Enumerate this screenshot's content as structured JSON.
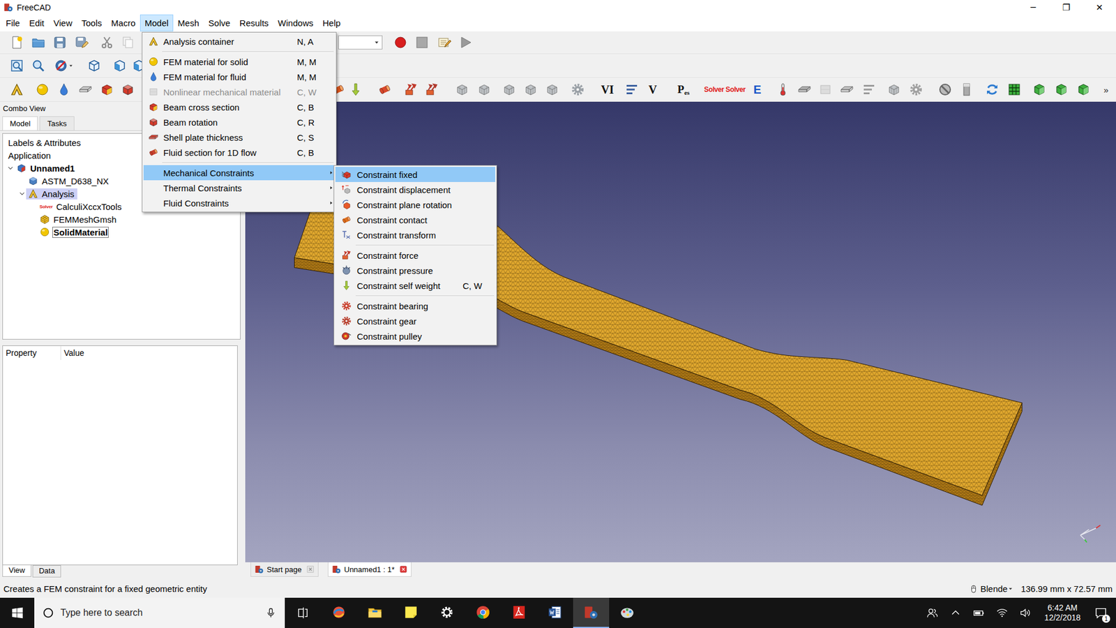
{
  "window": {
    "title": "FreeCAD",
    "controls": [
      "─",
      "❐",
      "✕"
    ]
  },
  "menubar": [
    {
      "label": "File",
      "selected": false
    },
    {
      "label": "Edit",
      "selected": false
    },
    {
      "label": "View",
      "selected": false
    },
    {
      "label": "Tools",
      "selected": false
    },
    {
      "label": "Macro",
      "selected": false
    },
    {
      "label": "Model",
      "selected": true
    },
    {
      "label": "Mesh",
      "selected": false
    },
    {
      "label": "Solve",
      "selected": false
    },
    {
      "label": "Results",
      "selected": false
    },
    {
      "label": "Windows",
      "selected": false
    },
    {
      "label": "Help",
      "selected": false
    }
  ],
  "toolbar": {
    "vi": "VI",
    "v": "V",
    "p": "P",
    "p_sub": "es",
    "solver_a": "Solver",
    "solver_b": "Solver",
    "e": "E",
    "overflow": "»"
  },
  "combo_view": {
    "title": "Combo View",
    "tabs": [
      {
        "label": "Model",
        "selected": true
      },
      {
        "label": "Tasks",
        "selected": false
      }
    ],
    "tree": [
      {
        "label": "Labels & Attributes",
        "kind": "header",
        "bold": false,
        "selected": false
      },
      {
        "label": "Application",
        "kind": "header",
        "bold": false,
        "selected": false
      },
      {
        "label": "Unnamed1",
        "kind": "document",
        "bold": true,
        "selected": false,
        "expanded": true,
        "children": [
          {
            "label": "ASTM_D638_NX",
            "kind": "part",
            "bold": false,
            "selected": false
          },
          {
            "label": "Analysis",
            "kind": "analysis",
            "bold": false,
            "selected": true,
            "expanded": true,
            "children": [
              {
                "label": "CalculiXccxTools",
                "kind": "solver",
                "bold": false,
                "selected": false,
                "icon_text": "Solver"
              },
              {
                "label": "FEMMeshGmsh",
                "kind": "mesh",
                "bold": false,
                "selected": false
              },
              {
                "label": "SolidMaterial",
                "kind": "material",
                "bold": true,
                "selected": false,
                "editing": true
              }
            ]
          }
        ]
      }
    ],
    "property_columns": [
      "Property",
      "Value"
    ],
    "bottom_tabs": [
      {
        "label": "View",
        "selected": true
      },
      {
        "label": "Data",
        "selected": false
      }
    ]
  },
  "doc_tabs": [
    {
      "label": "Start page",
      "selected": false
    },
    {
      "label": "Unnamed1 : 1*",
      "selected": true
    }
  ],
  "model_menu": [
    {
      "kind": "item",
      "label": "Analysis container",
      "shortcut": "N, A",
      "disabled": false,
      "highlighted": false
    },
    {
      "kind": "separator"
    },
    {
      "kind": "item",
      "label": "FEM material for solid",
      "shortcut": "M, M",
      "disabled": false,
      "highlighted": false
    },
    {
      "kind": "item",
      "label": "FEM material for fluid",
      "shortcut": "M, M",
      "disabled": false,
      "highlighted": false
    },
    {
      "kind": "item",
      "label": "Nonlinear mechanical material",
      "shortcut": "C, W",
      "disabled": true,
      "highlighted": false
    },
    {
      "kind": "item",
      "label": "Beam cross section",
      "shortcut": "C, B",
      "disabled": false,
      "highlighted": false
    },
    {
      "kind": "item",
      "label": "Beam rotation",
      "shortcut": "C, R",
      "disabled": false,
      "highlighted": false
    },
    {
      "kind": "item",
      "label": "Shell plate thickness",
      "shortcut": "C, S",
      "disabled": false,
      "highlighted": false
    },
    {
      "kind": "item",
      "label": "Fluid section for 1D flow",
      "shortcut": "C, B",
      "disabled": false,
      "highlighted": false
    },
    {
      "kind": "separator"
    },
    {
      "kind": "submenu",
      "label": "Mechanical Constraints",
      "disabled": false,
      "highlighted": true
    },
    {
      "kind": "submenu",
      "label": "Thermal Constraints",
      "disabled": false,
      "highlighted": false
    },
    {
      "kind": "submenu",
      "label": "Fluid Constraints",
      "disabled": false,
      "highlighted": false
    }
  ],
  "mechanical_submenu": [
    {
      "kind": "item",
      "label": "Constraint fixed",
      "disabled": false,
      "highlighted": true
    },
    {
      "kind": "item",
      "label": "Constraint displacement",
      "disabled": false,
      "highlighted": false
    },
    {
      "kind": "item",
      "label": "Constraint plane rotation",
      "disabled": false,
      "highlighted": false
    },
    {
      "kind": "item",
      "label": "Constraint contact",
      "disabled": false,
      "highlighted": false
    },
    {
      "kind": "item",
      "label": "Constraint transform",
      "disabled": false,
      "highlighted": false
    },
    {
      "kind": "separator"
    },
    {
      "kind": "item",
      "label": "Constraint force",
      "disabled": false,
      "highlighted": false
    },
    {
      "kind": "item",
      "label": "Constraint pressure",
      "disabled": false,
      "highlighted": false
    },
    {
      "kind": "item",
      "label": "Constraint self weight",
      "shortcut": "C, W",
      "disabled": false,
      "highlighted": false
    },
    {
      "kind": "separator"
    },
    {
      "kind": "item",
      "label": "Constraint bearing",
      "disabled": false,
      "highlighted": false
    },
    {
      "kind": "item",
      "label": "Constraint gear",
      "disabled": false,
      "highlighted": false
    },
    {
      "kind": "item",
      "label": "Constraint pulley",
      "disabled": false,
      "highlighted": false
    }
  ],
  "status_bar": {
    "message": "Creates a FEM constraint for a fixed geometric entity",
    "navigation": "Blende",
    "dimensions": "136.99 mm x 72.57 mm"
  },
  "taskbar": {
    "search_placeholder": "Type here to search",
    "time": "6:42 AM",
    "date": "12/2/2018",
    "notifications": "1",
    "apps": [
      {
        "active": false
      },
      {
        "active": false
      },
      {
        "active": false
      },
      {
        "active": false
      },
      {
        "active": false
      },
      {
        "active": false
      },
      {
        "active": false
      },
      {
        "active": true
      },
      {
        "active": false
      }
    ]
  }
}
